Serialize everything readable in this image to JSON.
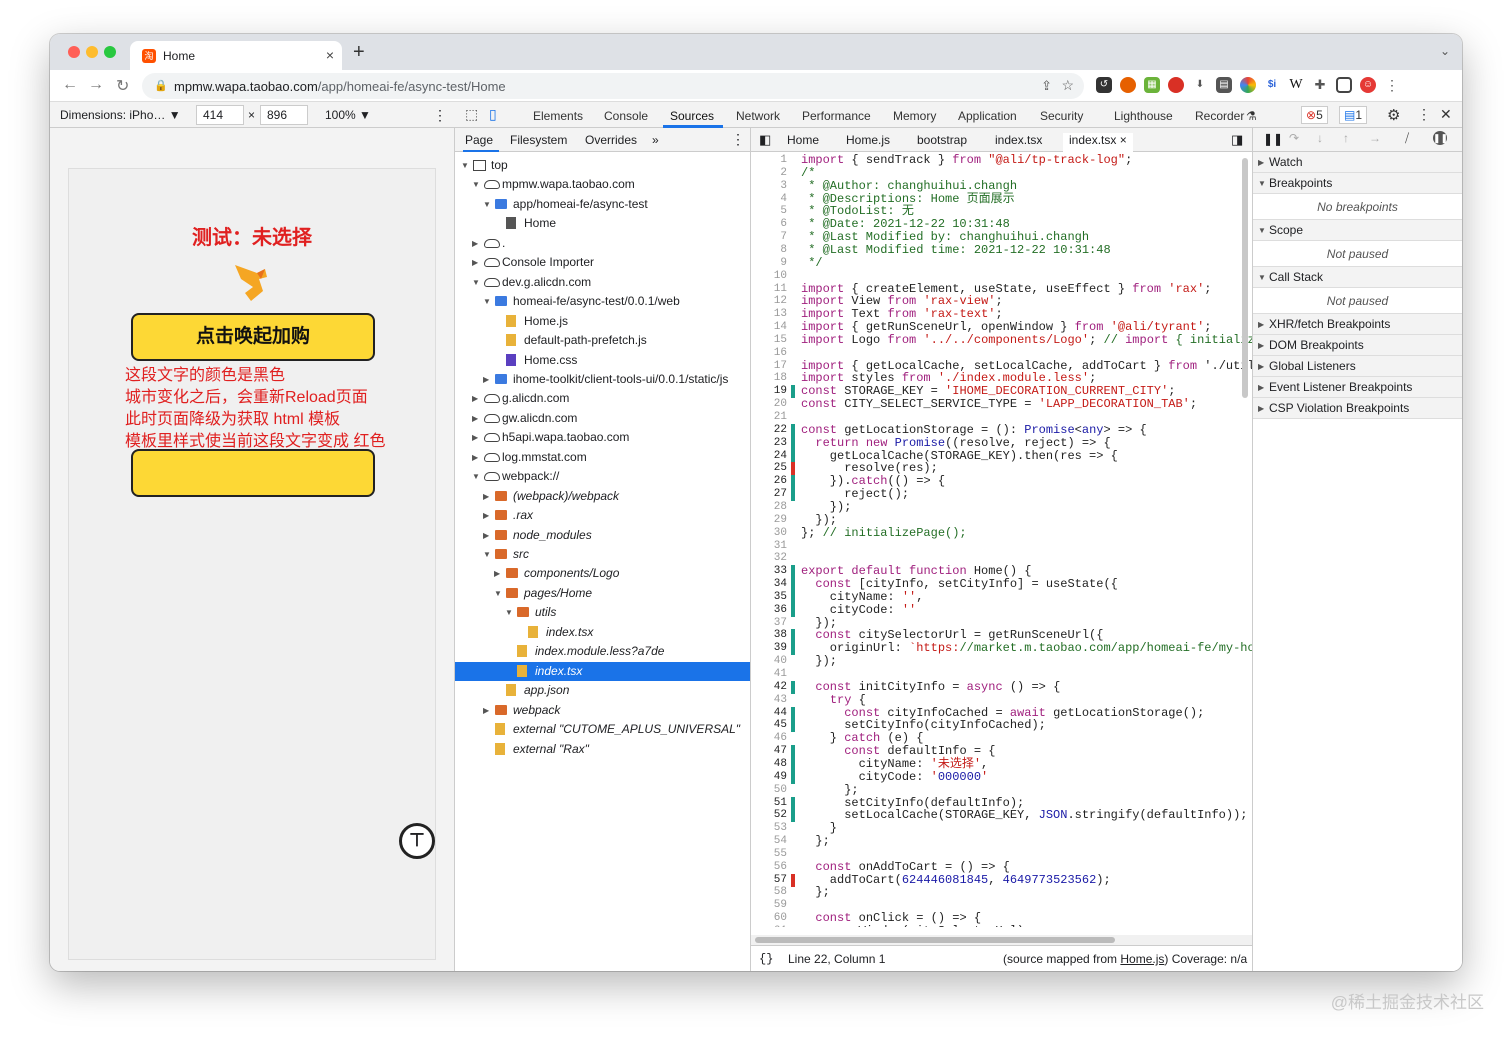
{
  "browser": {
    "tab_title": "Home",
    "tab_favicon": "淘",
    "url_host": "mpmw.wapa.taobao.com",
    "url_path": "/app/homeai-fe/async-test/Home",
    "extensions": [
      "lastpass-icon",
      "firefox-icon",
      "grid-icon",
      "record-icon",
      "download-icon",
      "calc-icon",
      "chrome-icon",
      "si-icon",
      "w-icon",
      "puzzle-icon",
      "sidebar-icon",
      "profile-icon",
      "menu-icon"
    ]
  },
  "device_toolbar": {
    "dimensions_label": "Dimensions: iPho…",
    "width": "414",
    "height": "896",
    "zoom": "100%"
  },
  "phone": {
    "title": "测试：未选择",
    "button1": "点击唤起加购",
    "button2": "",
    "red_text": [
      "这段文字的颜色是黑色",
      "城市变化之后，会重新Reload页面",
      "此时页面降级为获取 html 模板",
      "模板里样式使当前这段文字变成 红色"
    ]
  },
  "devtools": {
    "tabs": [
      "Elements",
      "Console",
      "Sources",
      "Network",
      "Performance",
      "Memory",
      "Application",
      "Security",
      "Lighthouse",
      "Recorder"
    ],
    "active_tab": "Sources",
    "error_count": "5",
    "message_count": "1",
    "nav_tabs": [
      "Page",
      "Filesystem",
      "Overrides",
      "»"
    ],
    "tree": [
      {
        "label": "top",
        "depth": 0,
        "icon": "frame",
        "arrow": "▼"
      },
      {
        "label": "mpmw.wapa.taobao.com",
        "depth": 1,
        "icon": "cloud",
        "arrow": "▼"
      },
      {
        "label": "app/homeai-fe/async-test",
        "depth": 2,
        "icon": "bfolder",
        "arrow": "▼"
      },
      {
        "label": "Home",
        "depth": 3,
        "icon": "gfile",
        "arrow": ""
      },
      {
        "label": ".",
        "depth": 1,
        "icon": "cloud",
        "arrow": "▶"
      },
      {
        "label": "Console Importer",
        "depth": 1,
        "icon": "cloud",
        "arrow": "▶"
      },
      {
        "label": "dev.g.alicdn.com",
        "depth": 1,
        "icon": "cloud",
        "arrow": "▼"
      },
      {
        "label": "homeai-fe/async-test/0.0.1/web",
        "depth": 2,
        "icon": "bfolder",
        "arrow": "▼"
      },
      {
        "label": "Home.js",
        "depth": 3,
        "icon": "file",
        "arrow": ""
      },
      {
        "label": "default-path-prefetch.js",
        "depth": 3,
        "icon": "file",
        "arrow": ""
      },
      {
        "label": "Home.css",
        "depth": 3,
        "icon": "pfile",
        "arrow": ""
      },
      {
        "label": "ihome-toolkit/client-tools-ui/0.0.1/static/js",
        "depth": 2,
        "icon": "bfolder",
        "arrow": "▶"
      },
      {
        "label": "g.alicdn.com",
        "depth": 1,
        "icon": "cloud",
        "arrow": "▶"
      },
      {
        "label": "gw.alicdn.com",
        "depth": 1,
        "icon": "cloud",
        "arrow": "▶"
      },
      {
        "label": "h5api.wapa.taobao.com",
        "depth": 1,
        "icon": "cloud",
        "arrow": "▶"
      },
      {
        "label": "log.mmstat.com",
        "depth": 1,
        "icon": "cloud",
        "arrow": "▶"
      },
      {
        "label": "webpack://",
        "depth": 1,
        "icon": "cloud",
        "arrow": "▼"
      },
      {
        "label": "(webpack)/webpack",
        "depth": 2,
        "icon": "folder",
        "arrow": "▶",
        "italic": true
      },
      {
        "label": ".rax",
        "depth": 2,
        "icon": "folder",
        "arrow": "▶",
        "italic": true
      },
      {
        "label": "node_modules",
        "depth": 2,
        "icon": "folder",
        "arrow": "▶",
        "italic": true
      },
      {
        "label": "src",
        "depth": 2,
        "icon": "folder",
        "arrow": "▼",
        "italic": true
      },
      {
        "label": "components/Logo",
        "depth": 3,
        "icon": "folder",
        "arrow": "▶",
        "italic": true
      },
      {
        "label": "pages/Home",
        "depth": 3,
        "icon": "folder",
        "arrow": "▼",
        "italic": true
      },
      {
        "label": "utils",
        "depth": 4,
        "icon": "folder",
        "arrow": "▼",
        "italic": true
      },
      {
        "label": "index.tsx",
        "depth": 5,
        "icon": "file",
        "arrow": "",
        "italic": true
      },
      {
        "label": "index.module.less?a7de",
        "depth": 4,
        "icon": "file",
        "arrow": "",
        "italic": true
      },
      {
        "label": "index.tsx",
        "depth": 4,
        "icon": "file",
        "arrow": "",
        "italic": true,
        "selected": true
      },
      {
        "label": "app.json",
        "depth": 3,
        "icon": "file",
        "arrow": "",
        "italic": true
      },
      {
        "label": "webpack",
        "depth": 2,
        "icon": "folder",
        "arrow": "▶",
        "italic": true
      },
      {
        "label": "external \"CUTOME_APLUS_UNIVERSAL\"",
        "depth": 2,
        "icon": "file",
        "arrow": "",
        "italic": true
      },
      {
        "label": "external \"Rax\"",
        "depth": 2,
        "icon": "file",
        "arrow": "",
        "italic": true
      }
    ],
    "editor_tabs": [
      "Home",
      "Home.js",
      "bootstrap",
      "index.tsx",
      "index.tsx ×"
    ],
    "code_lines": [
      "import { sendTrack } from \"@ali/tp-track-log\";",
      "/*",
      " * @Author: changhuihui.changh",
      " * @Descriptions: Home 页面展示",
      " * @TodoList: 无",
      " * @Date: 2021-12-22 10:31:48",
      " * @Last Modified by: changhuihui.changh",
      " * @Last Modified time: 2021-12-22 10:31:48",
      " */",
      "",
      "import { createElement, useState, useEffect } from 'rax';",
      "import View from 'rax-view';",
      "import Text from 'rax-text';",
      "import { getRunSceneUrl, openWindow } from '@ali/tyrant';",
      "import Logo from '../../components/Logo'; // import { initializ",
      "",
      "import { getLocalCache, setLocalCache, addToCart } from './util",
      "import styles from './index.module.less';",
      "const STORAGE_KEY = 'IHOME_DECORATION_CURRENT_CITY';",
      "const CITY_SELECT_SERVICE_TYPE = 'LAPP_DECORATION_TAB';",
      "",
      "const getLocationStorage = (): Promise<any> => {",
      "  return new Promise((resolve, reject) => {",
      "    getLocalCache(STORAGE_KEY).then(res => {",
      "      resolve(res);",
      "    }).catch(() => {",
      "      reject();",
      "    });",
      "  });",
      "}; // initializePage();",
      "",
      "",
      "export default function Home() {",
      "  const [cityInfo, setCityInfo] = useState({",
      "    cityName: '',",
      "    cityCode: ''",
      "  });",
      "  const citySelectorUrl = getRunSceneUrl({",
      "    originUrl: `https://market.m.taobao.com/app/homeai-fe/my-ho",
      "  });",
      "",
      "  const initCityInfo = async () => {",
      "    try {",
      "      const cityInfoCached = await getLocationStorage();",
      "      setCityInfo(cityInfoCached);",
      "    } catch (e) {",
      "      const defaultInfo = {",
      "        cityName: '未选择',",
      "        cityCode: '000000'",
      "      };",
      "      setCityInfo(defaultInfo);",
      "      setLocalCache(STORAGE_KEY, JSON.stringify(defaultInfo));",
      "    }",
      "  };",
      "",
      "  const onAddToCart = () => {",
      "    addToCart(624446081845, 4649773523562);",
      "  };",
      "",
      "  const onClick = () => {",
      "    openWindow(citySelectorUrl);"
    ],
    "status_position": "Line 22, Column 1",
    "status_source": "(source mapped from",
    "status_source_file": "Home.js",
    "status_coverage": ") Coverage: n/a",
    "debugger": {
      "sections": [
        "Watch",
        "Breakpoints",
        "Scope",
        "Call Stack",
        "XHR/fetch Breakpoints",
        "DOM Breakpoints",
        "Global Listeners",
        "Event Listener Breakpoints",
        "CSP Violation Breakpoints"
      ],
      "breakpoints_msg": "No breakpoints",
      "scope_msg": "Not paused",
      "callstack_msg": "Not paused"
    }
  },
  "watermark": "@稀土掘金技术社区"
}
